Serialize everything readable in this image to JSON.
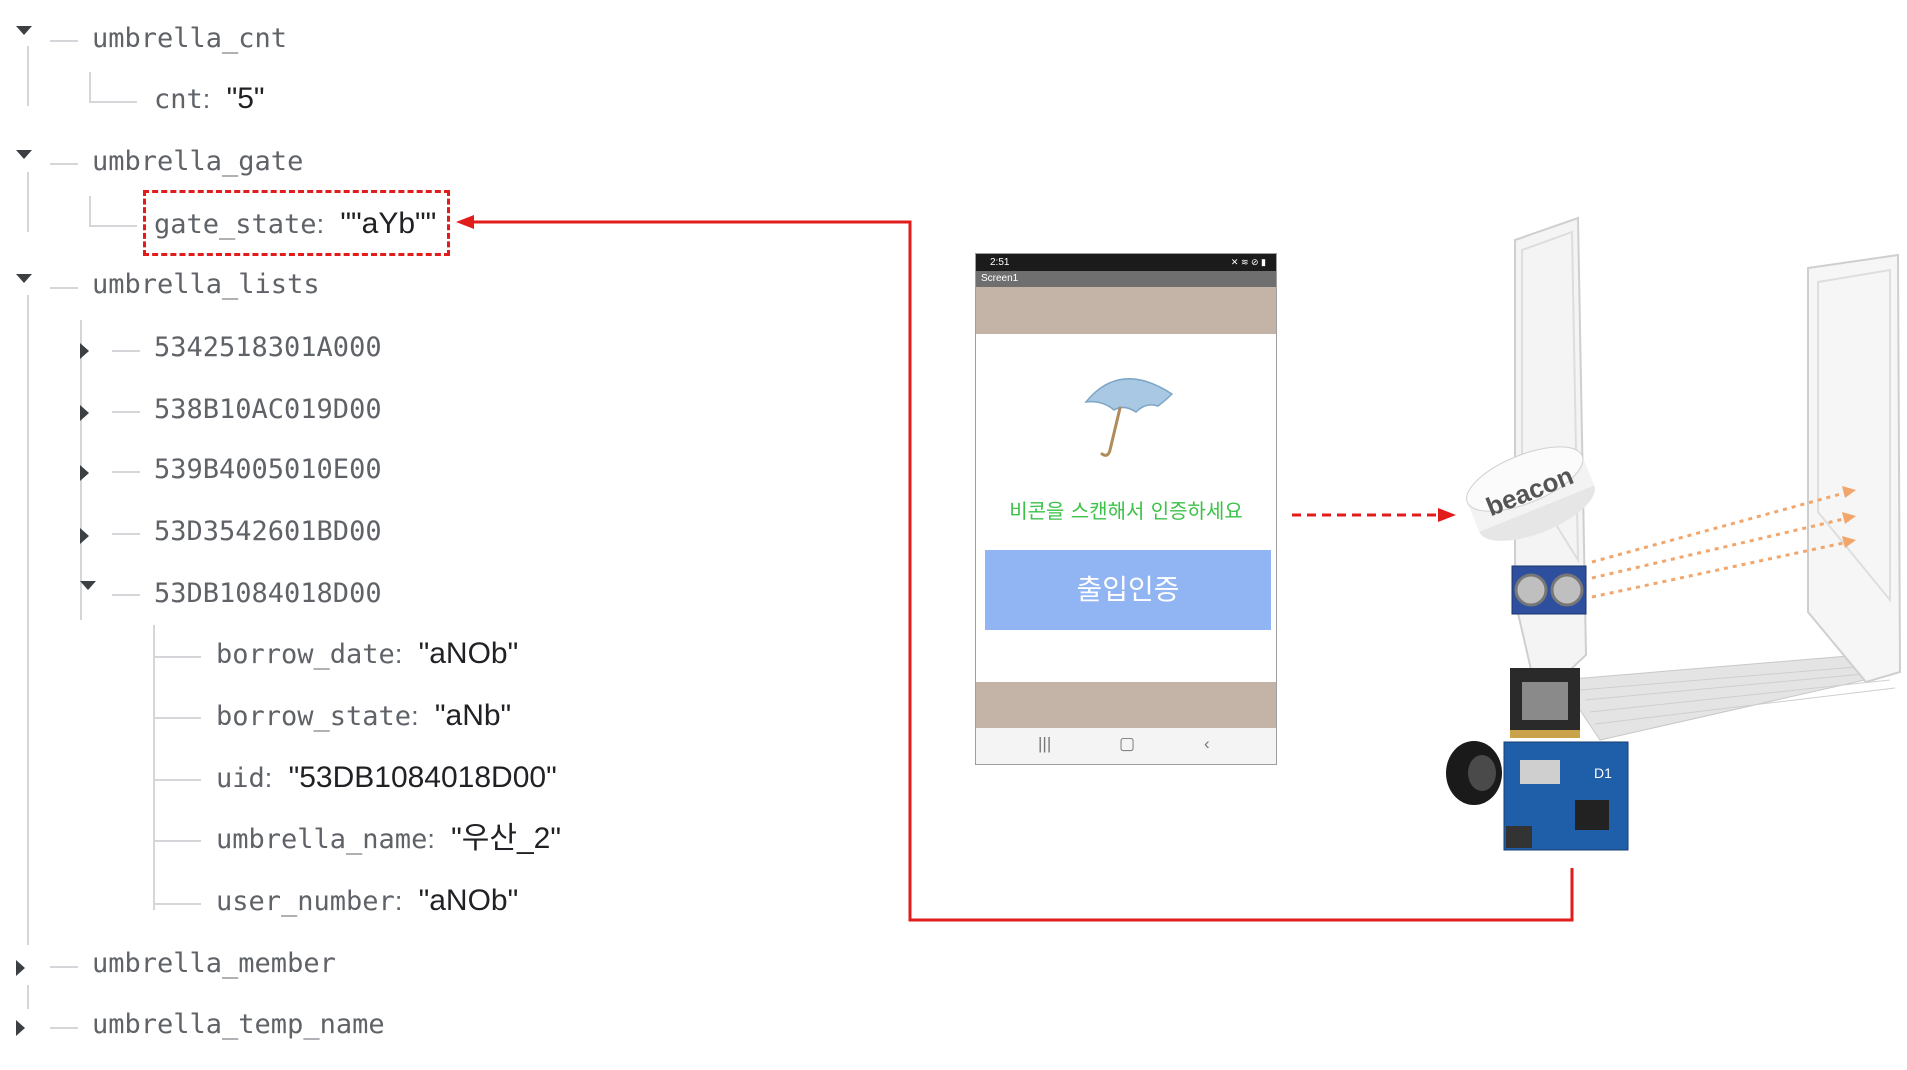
{
  "tree": {
    "umbrella_cnt": {
      "key": "umbrella_cnt",
      "child_key": "cnt",
      "child_value": "\"5\""
    },
    "umbrella_gate": {
      "key": "umbrella_gate",
      "child_key": "gate_state",
      "child_value": "\"\"aYb\"\""
    },
    "umbrella_lists": {
      "key": "umbrella_lists",
      "items": [
        "5342518301A000",
        "538B10AC019D00",
        "539B4005010E00",
        "53D3542601BD00",
        "53DB1084018D00"
      ],
      "expanded": {
        "borrow_date": {
          "key": "borrow_date",
          "value": "\"aNOb\""
        },
        "borrow_state": {
          "key": "borrow_state",
          "value": "\"aNb\""
        },
        "uid": {
          "key": "uid",
          "value": "\"53DB1084018D00\""
        },
        "umbrella_name": {
          "key": "umbrella_name",
          "value": "\"우산_2\""
        },
        "user_number": {
          "key": "user_number",
          "value": "\"aNOb\""
        }
      }
    },
    "umbrella_member": {
      "key": "umbrella_member"
    },
    "umbrella_temp_name": {
      "key": "umbrella_temp_name"
    },
    "separator": ":"
  },
  "phone": {
    "time": "2:51",
    "title": "Screen1",
    "message": "비콘을 스캔해서 인증하세요",
    "button_label": "출입인증",
    "nav_icons": [
      "recent-apps-icon",
      "home-icon",
      "back-icon"
    ]
  },
  "device": {
    "beacon_label": "beacon",
    "board_label": "D1"
  },
  "colors": {
    "arrow": "#e21b1b",
    "message": "#3cc248",
    "button": "#91b4f3",
    "band": "#c4b4a7",
    "sensor_waves": "#f2a66b"
  }
}
